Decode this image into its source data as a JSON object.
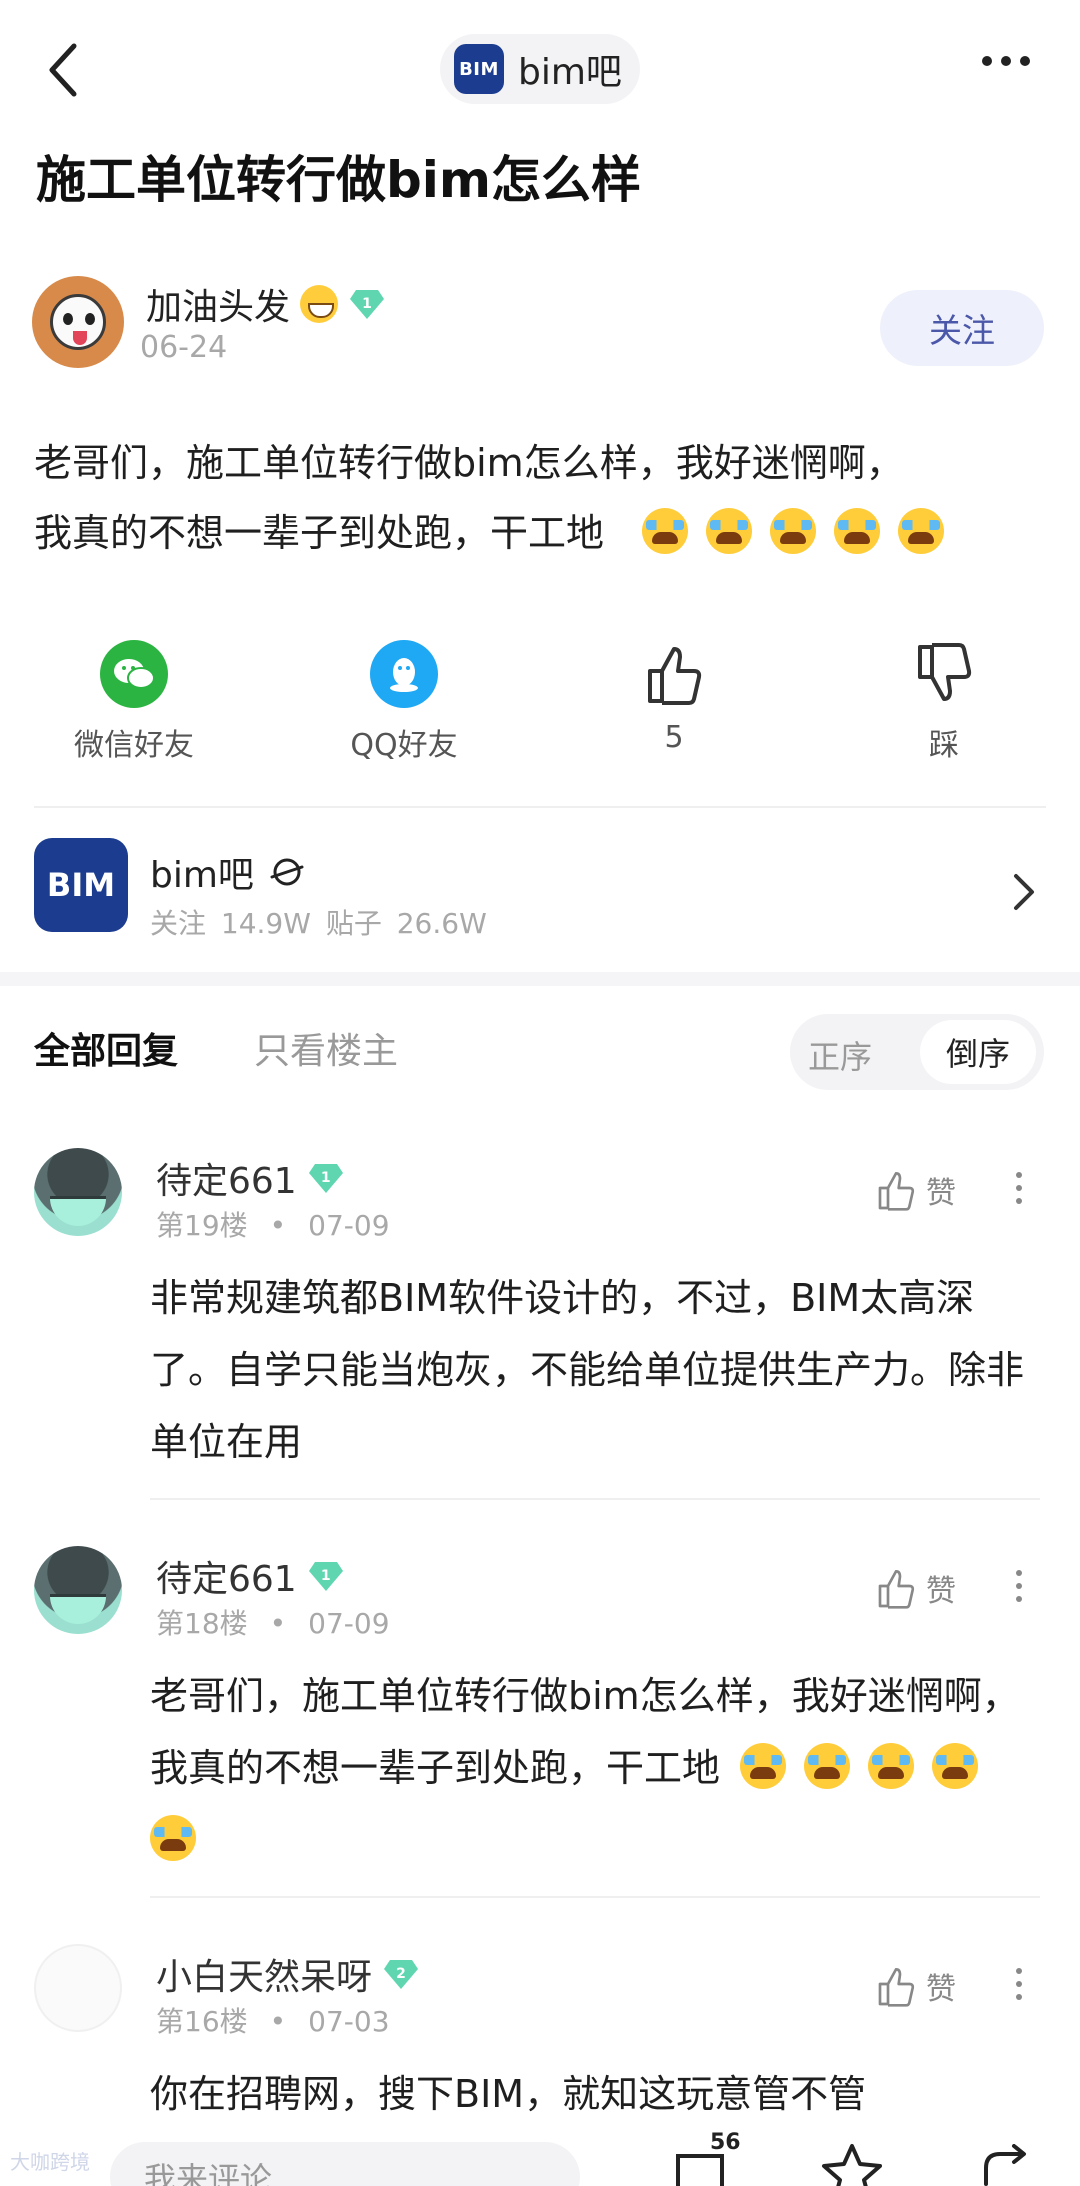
{
  "header": {
    "forum_name": "bim吧",
    "logo_text": "BIM"
  },
  "post": {
    "title": "施工单位转行做bim怎么样",
    "author": {
      "name": "加油头发",
      "date": "06-24",
      "level": "1"
    },
    "follow_label": "关注",
    "body_line1": "老哥们，施工单位转行做bim怎么样，我好迷惘啊，",
    "body_line2": "我真的不想一辈子到处跑，干工地"
  },
  "share": {
    "wechat_label": "微信好友",
    "qq_label": "QQ好友",
    "like_count": "5",
    "dislike_label": "踩"
  },
  "forum_card": {
    "logo_text": "BIM",
    "name": "bim吧",
    "stats": "关注 14.9W  贴子 26.6W"
  },
  "reply_tabs": {
    "all": "全部回复",
    "op_only": "只看楼主",
    "asc": "正序",
    "desc": "倒序"
  },
  "replies": [
    {
      "name": "待定661",
      "level": "1",
      "floor": "第19楼",
      "date": "07-09",
      "like_label": "赞",
      "text": "非常规建筑都BIM软件设计的，不过，BIM太高深了。自学只能当炮灰，不能给单位提供生产力。除非单位在用"
    },
    {
      "name": "待定661",
      "level": "1",
      "floor": "第18楼",
      "date": "07-09",
      "like_label": "赞",
      "text": "老哥们，施工单位转行做bim怎么样，我好迷惘啊，我真的不想一辈子到处跑，干工地"
    },
    {
      "name": "小白天然呆呀",
      "level": "2",
      "floor": "第16楼",
      "date": "07-03",
      "like_label": "赞",
      "text": "你在招聘网，搜下BIM，就知这玩意管不管"
    }
  ],
  "bottom": {
    "comment_placeholder": "我来评论",
    "comment_count": "56"
  },
  "watermark": "大咖跨境",
  "colors": {
    "bim_blue": "#1c3d8f",
    "badge_green": "#5fd6b0",
    "wechat_green": "#2bb441",
    "qq_blue": "#1fa8f4",
    "follow_text": "#4b57a8"
  }
}
